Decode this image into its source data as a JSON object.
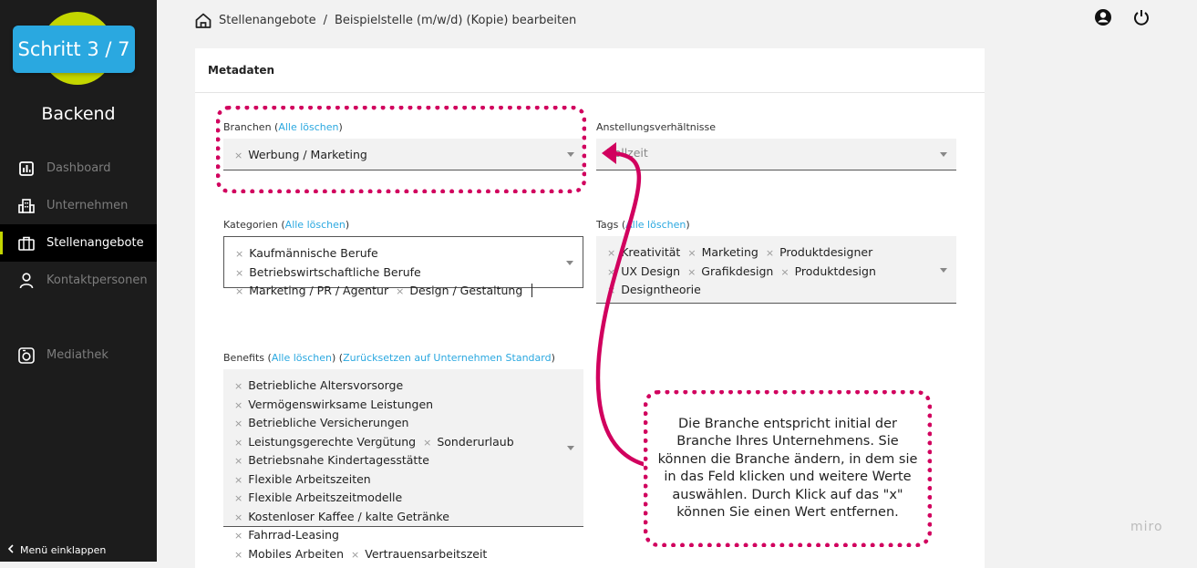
{
  "sidebar": {
    "step_badge": "Schritt 3 / 7",
    "brand": "Backend",
    "items": [
      {
        "label": "Dashboard",
        "icon": "chart-icon"
      },
      {
        "label": "Unternehmen",
        "icon": "building-icon"
      },
      {
        "label": "Stellenangebote",
        "icon": "briefcase-icon",
        "active": true
      },
      {
        "label": "Kontaktpersonen",
        "icon": "person-icon"
      }
    ],
    "media": {
      "label": "Mediathek",
      "icon": "camera-icon"
    },
    "collapse_label": "Menü einklappen"
  },
  "breadcrumb": {
    "root": "Stellenangebote",
    "separator": "/",
    "current": "Beispielstelle (m/w/d) (Kopie) bearbeiten"
  },
  "card": {
    "title": "Metadaten",
    "branchen": {
      "label": "Branchen",
      "clear": "Alle löschen",
      "chips": [
        "Werbung / Marketing"
      ]
    },
    "anstellung": {
      "label": "Anstellungsverhältnisse",
      "value": "Vollzeit"
    },
    "kategorien": {
      "label": "Kategorien",
      "clear": "Alle löschen",
      "chips": [
        "Kaufmännische Berufe",
        "Betriebswirtschaftliche Berufe",
        "Marketing / PR / Agentur",
        "Design / Gestaltung"
      ]
    },
    "tags": {
      "label": "Tags",
      "clear": "Alle löschen",
      "chips": [
        "Kreativität",
        "Marketing",
        "Produktdesigner",
        "UX Design",
        "Grafikdesign",
        "Produktdesign",
        "Designtheorie"
      ]
    },
    "benefits": {
      "label": "Benefits",
      "clear": "Alle löschen",
      "reset": "Zurücksetzen auf Unternehmen Standard",
      "chips": [
        "Betriebliche Altersvorsorge",
        "Vermögenswirksame Leistungen",
        "Betriebliche Versicherungen",
        "Leistungsgerechte Vergütung",
        "Sonderurlaub",
        "Betriebsnahe Kindertagesstätte",
        "Flexible Arbeitszeiten",
        "Flexible Arbeitszeitmodelle",
        "Kostenloser Kaffee / kalte Getränke",
        "Fahrrad-Leasing",
        "Mobiles Arbeiten",
        "Vertrauensarbeitszeit"
      ]
    }
  },
  "tip_text": "Die Branche entspricht initial der Branche Ihres Unternehmens. Sie können die Branche ändern, in dem sie in das Feld klicken und weitere Werte auswählen. Durch Klick auf das \"x\" können Sie einen Wert entfernen.",
  "watermark": "miro",
  "colors": {
    "accent": "#2aa8e0",
    "brand_green": "#c3d600",
    "annotation": "#d1005e",
    "sidebar_bg": "#1c1c1c"
  }
}
